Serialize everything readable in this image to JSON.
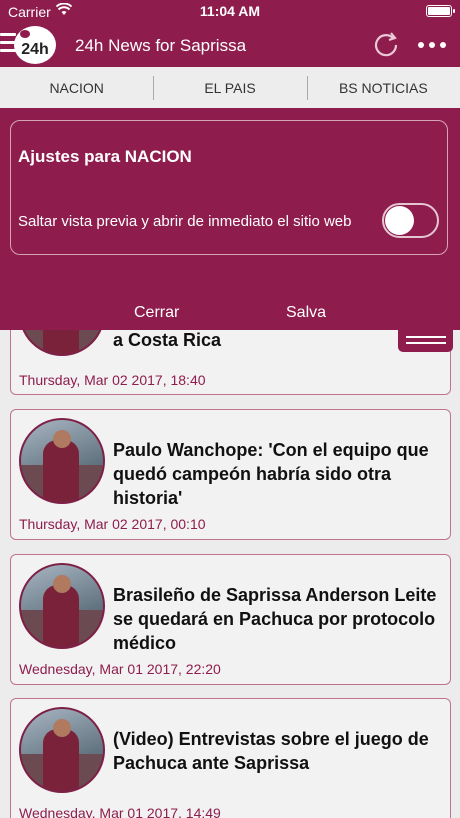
{
  "status": {
    "carrier": "Carrier",
    "time": "11:04 AM"
  },
  "header": {
    "logo_text": "24h",
    "title": "24h News for Saprissa"
  },
  "tabs": [
    {
      "label": "NACION"
    },
    {
      "label": "EL PAIS"
    },
    {
      "label": "BS NOTICIAS"
    }
  ],
  "settings": {
    "title": "Ajustes para NACION",
    "option_label": "Saltar vista previa y abrir de inmediato el sitio web",
    "toggle_on": false,
    "cancel_label": "Cerrar",
    "save_label": "Salva"
  },
  "articles": [
    {
      "headline": "a Costa Rica",
      "date": "Thursday, Mar 02 2017, 18:40"
    },
    {
      "headline": "Paulo Wanchope: 'Con el equipo que quedó campeón habría sido otra historia'",
      "date": "Thursday, Mar 02 2017, 00:10"
    },
    {
      "headline": "Brasileño de Saprissa Anderson Leite se quedará en Pachuca por protocolo médico",
      "date": "Wednesday, Mar 01 2017, 22:20"
    },
    {
      "headline": "(Video) Entrevistas sobre el juego de Pachuca ante Saprissa",
      "date": "Wednesday, Mar 01 2017, 14:49"
    }
  ],
  "colors": {
    "brand": "#8e1d4d",
    "background": "#ececec"
  },
  "icons": {
    "menu": "menu-icon",
    "refresh": "refresh-icon",
    "more": "more-icon",
    "wifi": "wifi-icon",
    "battery": "battery-icon"
  }
}
